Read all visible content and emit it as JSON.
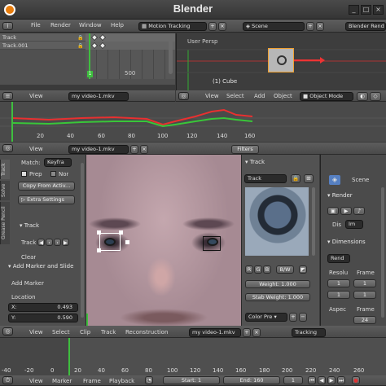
{
  "app": {
    "title": "Blender",
    "menus": [
      "File",
      "Render",
      "Window",
      "Help"
    ],
    "layout": "Motion Tracking",
    "scene": "Scene",
    "engine": "Blender Rend"
  },
  "dopesheet": {
    "tracks": [
      "Track",
      "Track.001"
    ],
    "frame_label": "500"
  },
  "viewport": {
    "view_name": "User Persp",
    "object_label": "(1) Cube",
    "menus": [
      "View",
      "Select",
      "Add",
      "Object"
    ],
    "mode": "Object Mode"
  },
  "graph": {
    "header_menus": [
      "View"
    ],
    "clip": "my video-1.mkv",
    "x_ticks": [
      "20",
      "40",
      "60",
      "80",
      "100",
      "120",
      "140",
      "160"
    ]
  },
  "clip_editor": {
    "header_menus": [
      "View"
    ],
    "clip": "my video-1.mkv",
    "filters_label": "Filters",
    "tabs": [
      "Track",
      "Solve",
      "Grease Pencil"
    ],
    "match_label": "Match:",
    "match_value": "Keyfra",
    "prep_label": "Prep",
    "nor_label": "Nor",
    "copy_btn": "Copy From Activ...",
    "extra_btn": "Extra Settings",
    "track_panel": "Track",
    "track_label": "Track",
    "clear_label": "Clear",
    "add_marker_panel": "Add Marker and Slide",
    "add_marker_btn": "Add Marker",
    "location_label": "Location",
    "loc_x_label": "X:",
    "loc_x": "0.493",
    "loc_y_label": "Y:",
    "loc_y": "0.590",
    "bottom_menus": [
      "View",
      "Select",
      "Clip",
      "Track",
      "Reconstruction"
    ],
    "tracking_label": "Tracking"
  },
  "track_props": {
    "panel": "Track",
    "name": "Track",
    "rgb": [
      "R",
      "G",
      "B"
    ],
    "bw": "B/W",
    "weight": "Weight: 1.000",
    "stab_weight": "Stab Weight: 1.000",
    "color_pre": "Color Pre"
  },
  "render_panel": {
    "scene": "Scene",
    "render_title": "Render",
    "dis_label": "Dis",
    "dis_value": "Im",
    "dimensions_title": "Dimensions",
    "rend_label": "Rend",
    "resolu_label": "Resolu",
    "frame_label": "Frame",
    "aspec_label": "Aspec",
    "frame2_label": "Frame",
    "frame_value": "24",
    "num1": "1",
    "num2": "1",
    "num3": "1",
    "num4": "1"
  },
  "timeline": {
    "ticks": [
      "-40",
      "-20",
      "0",
      "20",
      "40",
      "60",
      "80",
      "100",
      "120",
      "140",
      "160",
      "180",
      "200",
      "220",
      "240",
      "260"
    ],
    "menus": [
      "View",
      "Marker",
      "Frame",
      "Playback"
    ],
    "start": "Start:",
    "start_val": "1",
    "end": "End:",
    "end_val": "160",
    "current": "1"
  },
  "colors": {
    "accent_blue": "#5680c2",
    "graph_red": "#e83030",
    "graph_green": "#39c639",
    "frame_line": "#3fbf3f"
  }
}
